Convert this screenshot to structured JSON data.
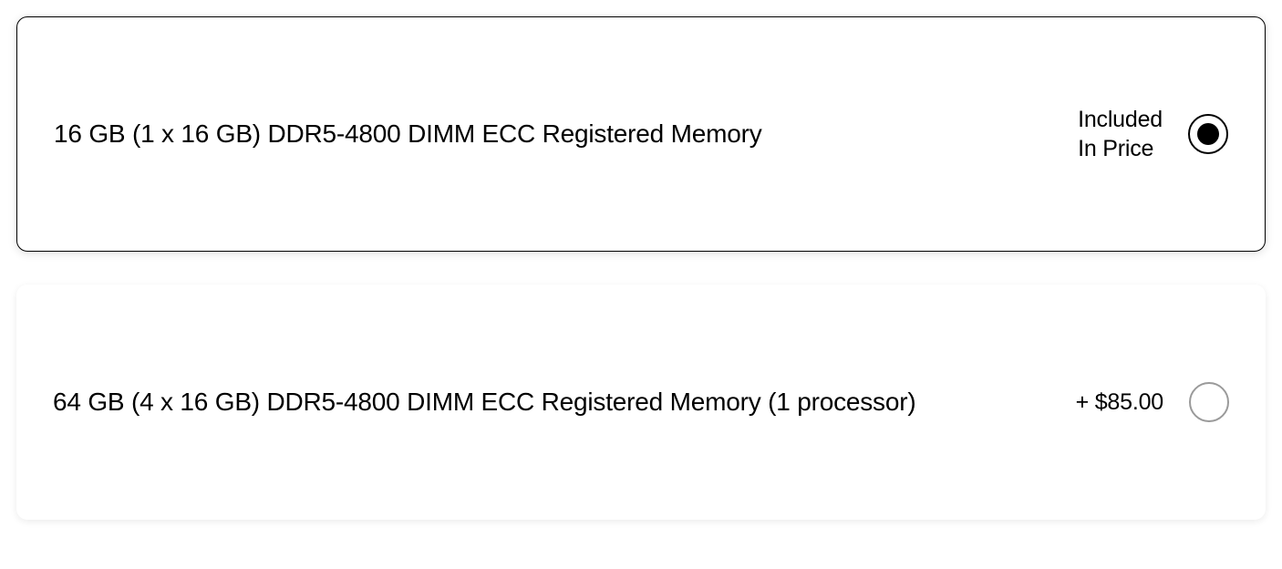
{
  "options": [
    {
      "label": "16 GB (1 x 16 GB) DDR5-4800 DIMM ECC Registered Memory",
      "price": "Included\nIn Price",
      "selected": true
    },
    {
      "label": "64 GB (4 x 16 GB) DDR5-4800 DIMM ECC Registered Memory (1 processor)",
      "price": "+ $85.00",
      "selected": false
    }
  ]
}
